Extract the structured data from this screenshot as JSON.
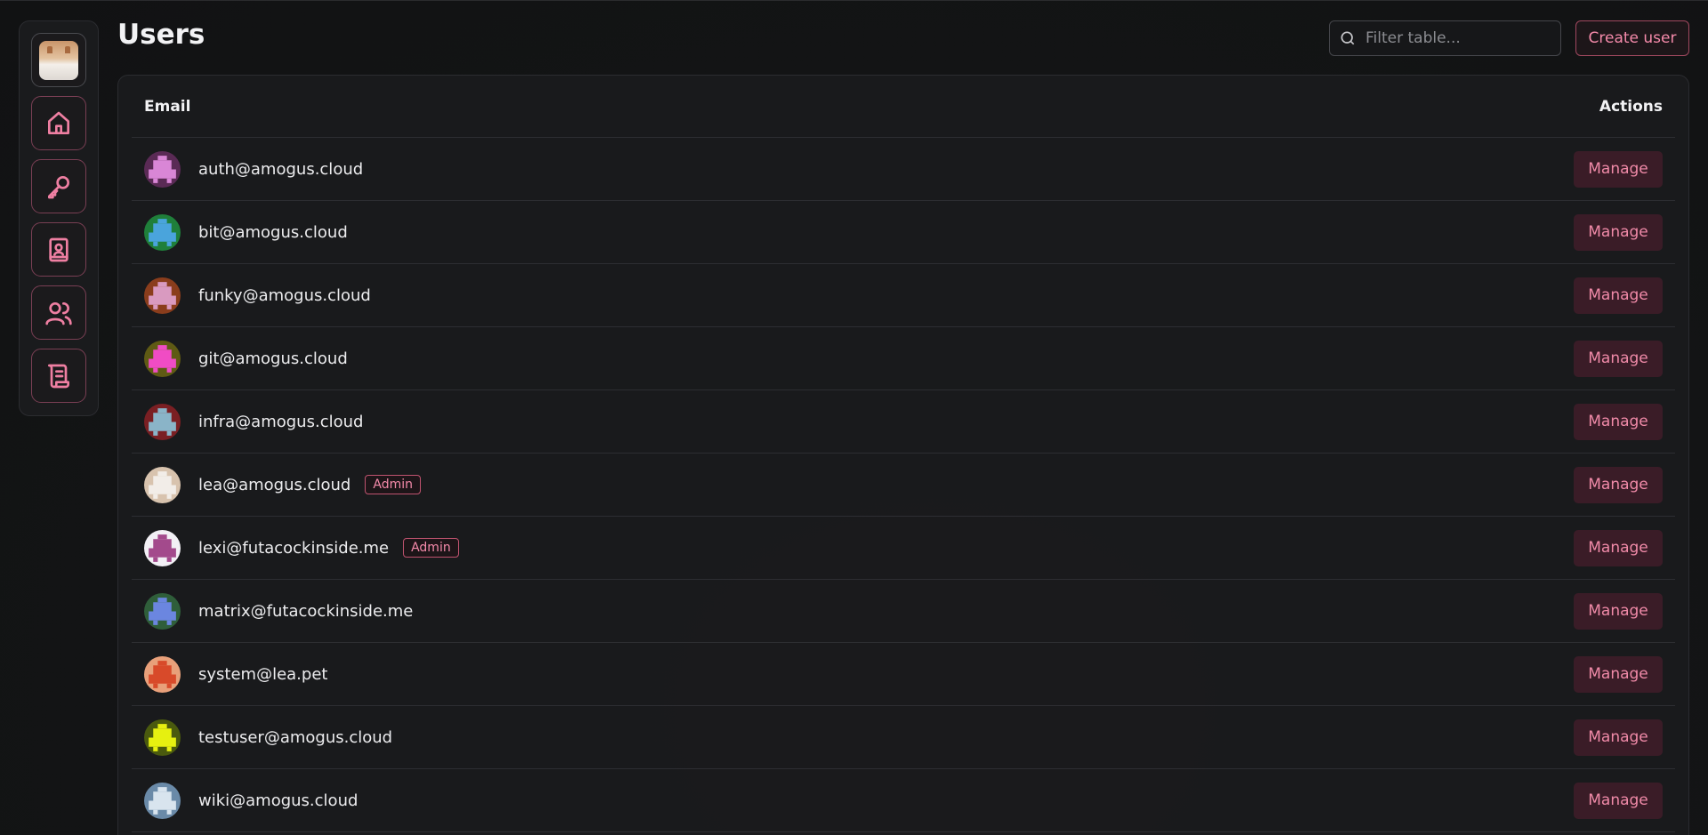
{
  "page": {
    "title": "Users"
  },
  "search": {
    "placeholder": "Filter table..."
  },
  "toolbar": {
    "create_label": "Create user"
  },
  "sidebar": {
    "items": [
      {
        "name": "profile",
        "icon": "cat-avatar"
      },
      {
        "name": "home",
        "icon": "home-icon"
      },
      {
        "name": "keys",
        "icon": "key-icon"
      },
      {
        "name": "contacts",
        "icon": "contact-book-icon"
      },
      {
        "name": "users",
        "icon": "users-icon"
      },
      {
        "name": "logs",
        "icon": "scroll-icon"
      }
    ]
  },
  "table": {
    "headers": {
      "email": "Email",
      "actions": "Actions"
    },
    "manage_label": "Manage",
    "rows": [
      {
        "email": "auth@amogus.cloud",
        "badge": "",
        "avatar": "#5a2a55",
        "fg": "#d986d6"
      },
      {
        "email": "bit@amogus.cloud",
        "badge": "",
        "avatar": "#1f7f3a",
        "fg": "#4aa4dc"
      },
      {
        "email": "funky@amogus.cloud",
        "badge": "",
        "avatar": "#8a3d1c",
        "fg": "#d99ac0"
      },
      {
        "email": "git@amogus.cloud",
        "badge": "",
        "avatar": "#5f5a14",
        "fg": "#f04cc4"
      },
      {
        "email": "infra@amogus.cloud",
        "badge": "",
        "avatar": "#7a1f23",
        "fg": "#8ab4c8"
      },
      {
        "email": "lea@amogus.cloud",
        "badge": "Admin",
        "avatar": "#d8c3ae",
        "fg": "#f2ede8"
      },
      {
        "email": "lexi@futacockinside.me",
        "badge": "Admin",
        "avatar": "#f2f0f5",
        "fg": "#a34a8c"
      },
      {
        "email": "matrix@futacockinside.me",
        "badge": "",
        "avatar": "#2f5e3a",
        "fg": "#6b86e0"
      },
      {
        "email": "system@lea.pet",
        "badge": "",
        "avatar": "#e8a07a",
        "fg": "#d84a2a"
      },
      {
        "email": "testuser@amogus.cloud",
        "badge": "",
        "avatar": "#4a5a0e",
        "fg": "#e6f010"
      },
      {
        "email": "wiki@amogus.cloud",
        "badge": "",
        "avatar": "#6a8aa8",
        "fg": "#d8e4ee"
      }
    ]
  }
}
